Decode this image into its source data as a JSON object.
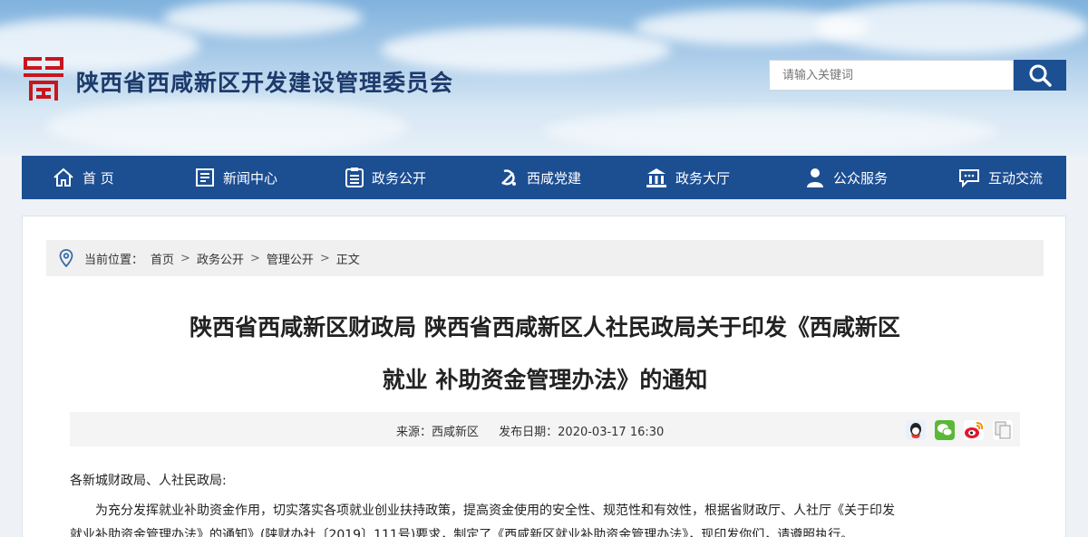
{
  "header": {
    "site_title": "陕西省西咸新区开发建设管理委员会",
    "search_placeholder": "请输入关键词"
  },
  "nav": {
    "items": [
      {
        "label": "首 页",
        "icon": "home-icon"
      },
      {
        "label": "新闻中心",
        "icon": "news-icon"
      },
      {
        "label": "政务公开",
        "icon": "document-list-icon"
      },
      {
        "label": "西咸党建",
        "icon": "party-emblem-icon"
      },
      {
        "label": "政务大厅",
        "icon": "building-icon"
      },
      {
        "label": "公众服务",
        "icon": "person-icon"
      },
      {
        "label": "互动交流",
        "icon": "chat-icon"
      }
    ]
  },
  "breadcrumb": {
    "label": "当前位置：",
    "items": [
      "首页",
      "政务公开",
      "管理公开",
      "正文"
    ]
  },
  "article": {
    "title_line1": "陕西省西咸新区财政局 陕西省西咸新区人社民政局关于印发《西咸新区",
    "title_line2": "就业 补助资金管理办法》的通知",
    "source": "来源：西咸新区",
    "publish_date": "发布日期：2020-03-17 16:30",
    "salutation": "各新城财政局、人社民政局:",
    "paragraph1": "为充分发挥就业补助资金作用，切实落实各项就业创业扶持政策，提高资金使用的安全性、规范性和有效性，根据省财政厅、人社厅《关于印发",
    "paragraph2": "就业补助资金管理办法》的通知》(陕财办社〔2019〕111号)要求，制定了《西咸新区就业补助资金管理办法》，现印发你们，请遵照执行。"
  },
  "share": [
    "qq-icon",
    "wechat-icon",
    "weibo-icon",
    "copy-icon"
  ],
  "colors": {
    "nav_bg": "#1c4e92",
    "title_text": "#1d3a6b",
    "logo_red": "#c8161d"
  }
}
